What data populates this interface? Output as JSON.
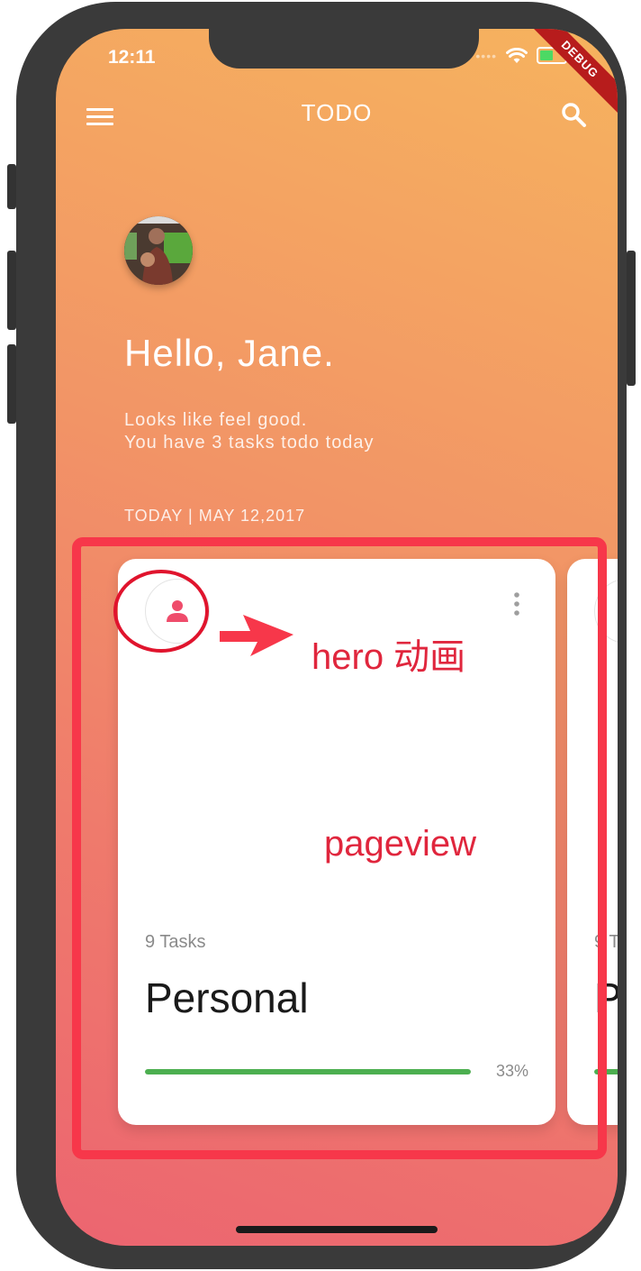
{
  "status_bar": {
    "time": "12:11",
    "debug_banner": "DEBUG",
    "battery_color": "#4cd964"
  },
  "appbar": {
    "title": "TODO",
    "menu_icon": "menu-icon",
    "search_icon": "search-icon"
  },
  "header": {
    "greeting": "Hello, Jane.",
    "subtitle_line1": "Looks like feel good.",
    "subtitle_line2": "You have 3 tasks todo today",
    "date": "TODAY | MAY 12,2017"
  },
  "cards": [
    {
      "icon": "person-icon",
      "tasks": "9 Tasks",
      "title": "Personal",
      "progress_text": "33%",
      "progress": 0.33,
      "progress_color": "#4caf50",
      "accent_color": "#ef4c6b"
    },
    {
      "tasks": "9 T",
      "title": "P"
    }
  ],
  "annotations": {
    "hero_label": "hero 动画",
    "pageview_label": "pageview",
    "color": "#f7374a"
  },
  "colors": {
    "gradient_top": "#f6b35e",
    "gradient_bottom": "#ec6570"
  }
}
